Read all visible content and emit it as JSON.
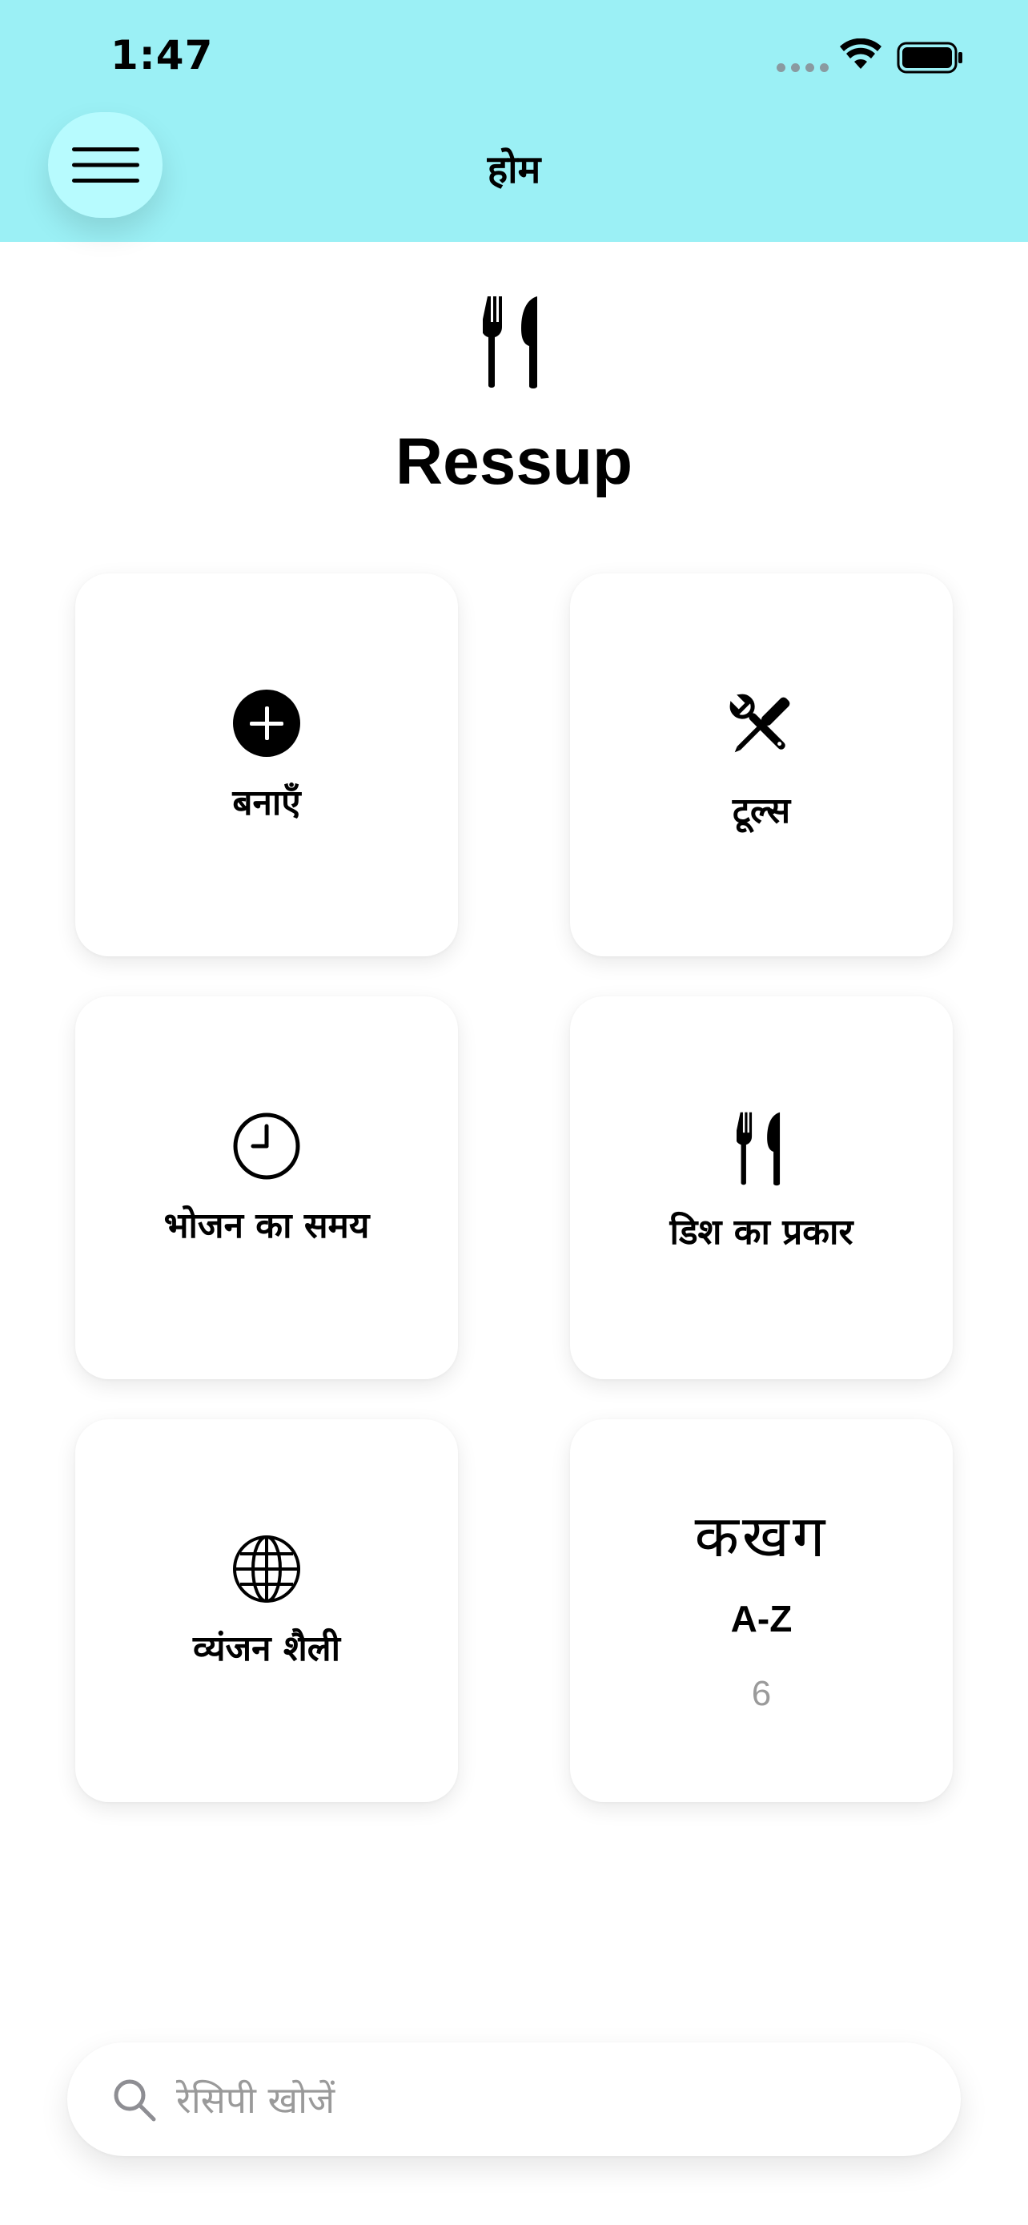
{
  "status_bar": {
    "time": "1:47"
  },
  "header": {
    "title": "होम",
    "menu_icon": "hamburger-menu-icon",
    "background": "#9BF0F5",
    "menu_button_color": "#B7FBFE"
  },
  "app": {
    "logo_icon": "fork-knife-icon",
    "name": "Ressup"
  },
  "cards": [
    {
      "icon": "plus-circle-icon",
      "label": "बनाएँ"
    },
    {
      "icon": "wrench-screwdriver-icon",
      "label": "टूल्स"
    },
    {
      "icon": "clock-icon",
      "label": "भोजन का समय"
    },
    {
      "icon": "fork-knife-icon",
      "label": "डिश का प्रकार"
    },
    {
      "icon": "globe-icon",
      "label": "व्यंजन शैली"
    },
    {
      "letters": "कखग",
      "range": "A-Z",
      "count": "6"
    }
  ],
  "search": {
    "placeholder": "रेसिपी खोजें",
    "value": "",
    "icon": "search-icon"
  }
}
